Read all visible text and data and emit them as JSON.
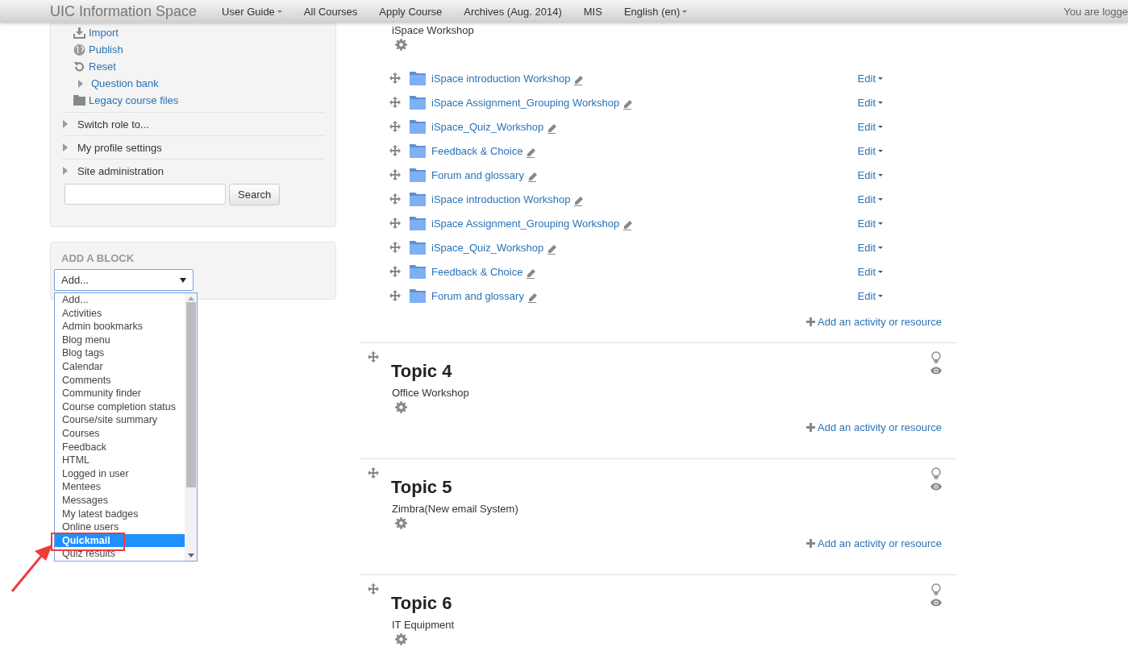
{
  "navbar": {
    "brand": "UIC Information Space",
    "items": [
      {
        "label": "User Guide",
        "has_menu": true
      },
      {
        "label": "All Courses",
        "has_menu": false
      },
      {
        "label": "Apply Course",
        "has_menu": false
      },
      {
        "label": "Archives (Aug. 2014)",
        "has_menu": false
      },
      {
        "label": "MIS",
        "has_menu": false
      },
      {
        "label": "English (en)",
        "has_menu": true
      }
    ],
    "login_text": "You are logge"
  },
  "navigation": {
    "items": [
      {
        "kind": "download",
        "label": "Import"
      },
      {
        "kind": "globe",
        "label": "Publish"
      },
      {
        "kind": "reset",
        "label": "Reset"
      },
      {
        "kind": "branch",
        "label": "Question bank",
        "expanded": false
      },
      {
        "kind": "folder",
        "label": "Legacy course files"
      }
    ],
    "sections": [
      {
        "label": "Switch role to...",
        "expanded": false
      },
      {
        "label": "My profile settings",
        "expanded": false
      },
      {
        "label": "Site administration",
        "expanded": false
      }
    ],
    "search": {
      "button": "Search"
    }
  },
  "add_block": {
    "title": "ADD A BLOCK",
    "select_value": "Add...",
    "options": [
      {
        "label": "Add...",
        "selected": false
      },
      {
        "label": "Activities",
        "selected": false
      },
      {
        "label": "Admin bookmarks",
        "selected": false
      },
      {
        "label": "Blog menu",
        "selected": false
      },
      {
        "label": "Blog tags",
        "selected": false
      },
      {
        "label": "Calendar",
        "selected": false
      },
      {
        "label": "Comments",
        "selected": false
      },
      {
        "label": "Community finder",
        "selected": false
      },
      {
        "label": "Course completion status",
        "selected": false
      },
      {
        "label": "Course/site summary",
        "selected": false
      },
      {
        "label": "Courses",
        "selected": false
      },
      {
        "label": "Feedback",
        "selected": false
      },
      {
        "label": "HTML",
        "selected": false
      },
      {
        "label": "Logged in user",
        "selected": false
      },
      {
        "label": "Mentees",
        "selected": false
      },
      {
        "label": "Messages",
        "selected": false
      },
      {
        "label": "My latest badges",
        "selected": false
      },
      {
        "label": "Online users",
        "selected": false
      },
      {
        "label": "Quickmail",
        "selected": true
      },
      {
        "label": "Quiz results",
        "selected": false
      }
    ]
  },
  "course": {
    "sections": [
      {
        "summary": "iSpace Workshop",
        "activities": [
          {
            "name": "iSpace introduction Workshop",
            "edit": "Edit"
          },
          {
            "name": "iSpace Assignment_Grouping Workshop",
            "edit": "Edit"
          },
          {
            "name": "iSpace_Quiz_Workshop",
            "edit": "Edit"
          },
          {
            "name": "Feedback & Choice",
            "edit": "Edit"
          },
          {
            "name": "Forum and glossary",
            "edit": "Edit"
          },
          {
            "name": "iSpace introduction Workshop",
            "edit": "Edit"
          },
          {
            "name": "iSpace Assignment_Grouping Workshop",
            "edit": "Edit"
          },
          {
            "name": "iSpace_Quiz_Workshop",
            "edit": "Edit"
          },
          {
            "name": "Feedback & Choice",
            "edit": "Edit"
          },
          {
            "name": "Forum and glossary",
            "edit": "Edit"
          }
        ],
        "add_link": "Add an activity or resource"
      },
      {
        "title": "Topic 4",
        "summary": "Office Workshop",
        "add_link": "Add an activity or resource"
      },
      {
        "title": "Topic 5",
        "summary": "Zimbra(New email System)",
        "add_link": "Add an activity or resource"
      },
      {
        "title": "Topic 6",
        "summary": "IT Equipment"
      }
    ]
  }
}
